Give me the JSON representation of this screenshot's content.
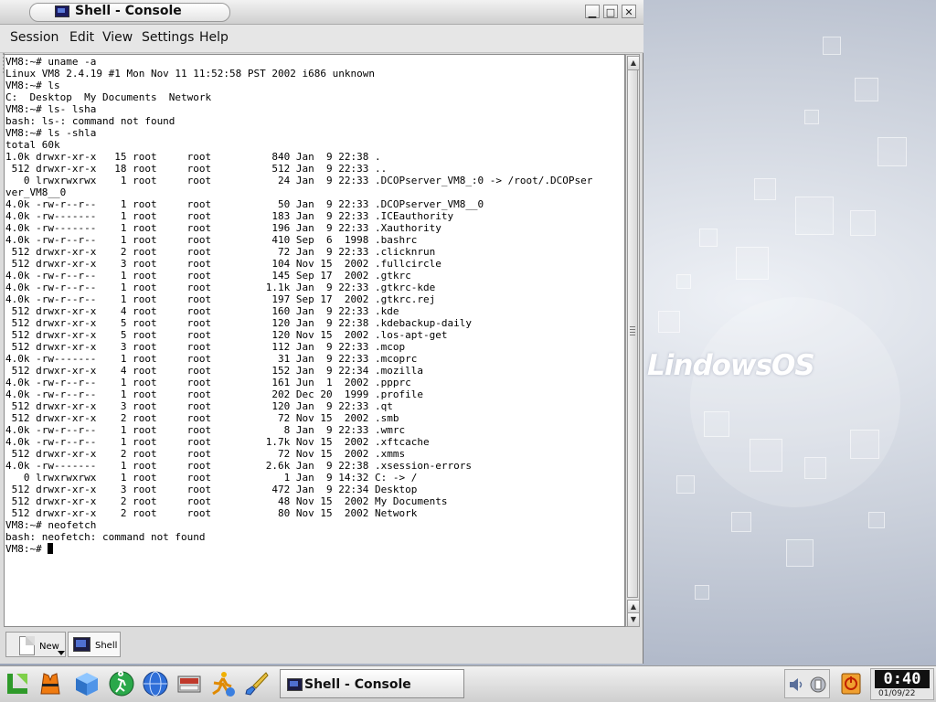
{
  "window": {
    "title": "Shell - Console",
    "buttons": {
      "minimize": "▁",
      "maximize": "□",
      "close": "✕"
    }
  },
  "menu": [
    "Session",
    "Edit",
    "View",
    "Settings",
    "Help"
  ],
  "terminal": {
    "lines": [
      "VM8:~# uname -a",
      "Linux VM8 2.4.19 #1 Mon Nov 11 11:52:58 PST 2002 i686 unknown",
      "VM8:~# ls",
      "C:  Desktop  My Documents  Network",
      "VM8:~# ls- lsha",
      "bash: ls-: command not found",
      "VM8:~# ls -shla",
      "total 60k",
      "1.0k drwxr-xr-x   15 root     root          840 Jan  9 22:38 .",
      " 512 drwxr-xr-x   18 root     root          512 Jan  9 22:33 ..",
      "   0 lrwxrwxrwx    1 root     root           24 Jan  9 22:33 .DCOPserver_VM8_:0 -> /root/.DCOPser",
      "ver_VM8__0",
      "4.0k -rw-r--r--    1 root     root           50 Jan  9 22:33 .DCOPserver_VM8__0",
      "4.0k -rw-------    1 root     root          183 Jan  9 22:33 .ICEauthority",
      "4.0k -rw-------    1 root     root          196 Jan  9 22:33 .Xauthority",
      "4.0k -rw-r--r--    1 root     root          410 Sep  6  1998 .bashrc",
      " 512 drwxr-xr-x    2 root     root           72 Jan  9 22:33 .clicknrun",
      " 512 drwxr-xr-x    3 root     root          104 Nov 15  2002 .fullcircle",
      "4.0k -rw-r--r--    1 root     root          145 Sep 17  2002 .gtkrc",
      "4.0k -rw-r--r--    1 root     root         1.1k Jan  9 22:33 .gtkrc-kde",
      "4.0k -rw-r--r--    1 root     root          197 Sep 17  2002 .gtkrc.rej",
      " 512 drwxr-xr-x    4 root     root          160 Jan  9 22:33 .kde",
      " 512 drwxr-xr-x    5 root     root          120 Jan  9 22:38 .kdebackup-daily",
      " 512 drwxr-xr-x    5 root     root          120 Nov 15  2002 .los-apt-get",
      " 512 drwxr-xr-x    3 root     root          112 Jan  9 22:33 .mcop",
      "4.0k -rw-------    1 root     root           31 Jan  9 22:33 .mcoprc",
      " 512 drwxr-xr-x    4 root     root          152 Jan  9 22:34 .mozilla",
      "4.0k -rw-r--r--    1 root     root          161 Jun  1  2002 .ppprc",
      "4.0k -rw-r--r--    1 root     root          202 Dec 20  1999 .profile",
      " 512 drwxr-xr-x    3 root     root          120 Jan  9 22:33 .qt",
      " 512 drwxr-xr-x    2 root     root           72 Nov 15  2002 .smb",
      "4.0k -rw-r--r--    1 root     root            8 Jan  9 22:33 .wmrc",
      "4.0k -rw-r--r--    1 root     root         1.7k Nov 15  2002 .xftcache",
      " 512 drwxr-xr-x    2 root     root           72 Nov 15  2002 .xmms",
      "4.0k -rw-------    1 root     root         2.6k Jan  9 22:38 .xsession-errors",
      "   0 lrwxrwxrwx    1 root     root            1 Jan  9 14:32 C: -> /",
      " 512 drwxr-xr-x    3 root     root          472 Jan  9 22:34 Desktop",
      " 512 drwxr-xr-x    2 root     root           48 Nov 15  2002 My Documents",
      " 512 drwxr-xr-x    2 root     root           80 Nov 15  2002 Network",
      "VM8:~# neofetch",
      "bash: neofetch: command not found"
    ],
    "prompt": "VM8:~# "
  },
  "sessions": {
    "new_label": "New",
    "tab_label": "Shell"
  },
  "taskbar": {
    "task_title": "Shell - Console",
    "clock_time": "0:40",
    "clock_date": "01/09/22"
  },
  "desktop": {
    "logo": "LindowsOS"
  }
}
